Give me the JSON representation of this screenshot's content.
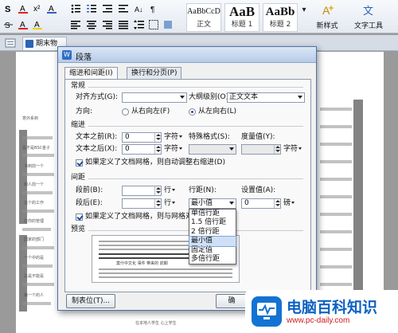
{
  "ribbon": {
    "styles": [
      {
        "sample": "AaBbCcD",
        "label": "正文"
      },
      {
        "sample": "AaB",
        "label": "标题 1"
      },
      {
        "sample": "AaBb",
        "label": "标题 2"
      }
    ],
    "new_style_label": "新样式",
    "text_tools_label": "文字工具"
  },
  "document": {
    "tab_label": "期末物",
    "snippets": [
      "意外系到",
      "是不是BSC金子",
      "书到前一个",
      "和人前一个",
      "这个的工作",
      "在你的管理",
      "国家的部门",
      "一个中的是",
      "总是不能是",
      "第一个的人"
    ],
    "footer_text": "在本地人学生 心上学生"
  },
  "dialog": {
    "title": "段落",
    "tabs": [
      "缩进和间距(I)",
      "换行和分页(P)"
    ],
    "general": {
      "heading": "常规",
      "alignment_label": "对齐方式(G):",
      "alignment_value": "",
      "outline_label": "大纲级别(O):",
      "outline_value": "正文文本",
      "direction_label": "方向:",
      "rtl_label": "从右向左(F)",
      "ltr_label": "从左向右(L)"
    },
    "indent": {
      "heading": "缩进",
      "before_label": "文本之前(R):",
      "before_value": "0",
      "before_unit": "字符",
      "special_label": "特殊格式(S):",
      "special_value": "",
      "measure_label": "度量值(Y):",
      "measure_value": "",
      "measure_unit": "字符",
      "after_label": "文本之后(X):",
      "after_value": "0",
      "after_unit": "字符",
      "auto_adjust_label": "如果定义了文档网格，则自动调整右缩进(D)"
    },
    "spacing": {
      "heading": "间距",
      "before_label": "段前(B):",
      "before_value": "",
      "before_unit": "行",
      "after_label": "段后(E):",
      "after_value": "",
      "after_unit": "行",
      "line_spacing_label": "行距(N):",
      "line_spacing_value": "最小值",
      "setting_label": "设置值(A):",
      "setting_value": "0",
      "setting_unit": "磅",
      "snap_label": "如果定义了文档网格，则与网格对齐"
    },
    "preview": {
      "heading": "预览",
      "preview_text": "莫什中文化 事件 带来的 前期"
    },
    "buttons": {
      "tabs_label": "制表位(T)...",
      "ok_label": "确"
    },
    "line_spacing_options": [
      "单倍行距",
      "1.5 倍行距",
      "2 倍行距",
      "最小值",
      "固定值",
      "多倍行距"
    ]
  },
  "watermark": {
    "title": "电脑百科知识",
    "url": "www.pc-daily.com"
  },
  "colors": {
    "accent": "#2f6fc5",
    "watermark_blue": "#0e62c2",
    "watermark_red": "#d0191b"
  }
}
